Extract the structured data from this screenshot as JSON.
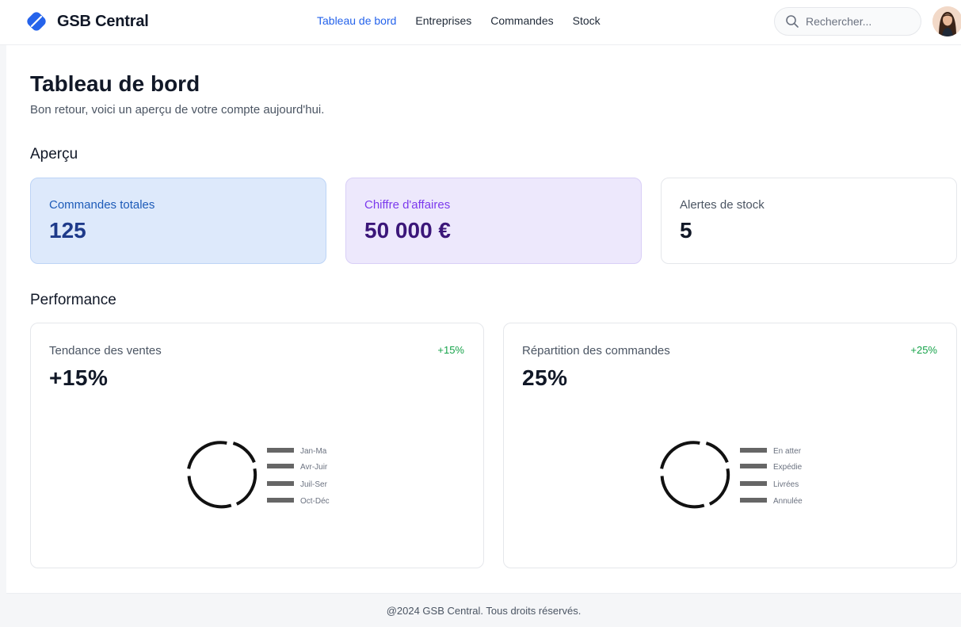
{
  "header": {
    "brand": "GSB Central",
    "nav": [
      "Tableau de bord",
      "Entreprises",
      "Commandes",
      "Stock"
    ],
    "active_nav": "Tableau de bord",
    "search_placeholder": "Rechercher..."
  },
  "page": {
    "title": "Tableau de bord",
    "subtitle": "Bon retour, voici un aperçu de votre compte aujourd'hui."
  },
  "overview": {
    "title": "Aperçu",
    "cards": [
      {
        "label": "Commandes totales",
        "value": "125"
      },
      {
        "label": "Chiffre d'affaires",
        "value": "50 000 €"
      },
      {
        "label": "Alertes de stock",
        "value": "5"
      }
    ]
  },
  "performance": {
    "title": "Performance",
    "cards": [
      {
        "label": "Tendance des ventes",
        "value": "+15%",
        "delta": "+15%",
        "legend": [
          "Jan-Ma",
          "Avr-Juir",
          "Juil-Ser",
          "Oct-Déc"
        ]
      },
      {
        "label": "Répartition des commandes",
        "value": "25%",
        "delta": "+25%",
        "legend": [
          "En atter",
          "Expédie",
          "Livrées",
          "Annulée"
        ]
      }
    ]
  },
  "colors": {
    "accent": "#2563eb",
    "positive": "#16a34a"
  },
  "footer": {
    "text": "@2024 GSB Central. Tous droits réservés."
  }
}
